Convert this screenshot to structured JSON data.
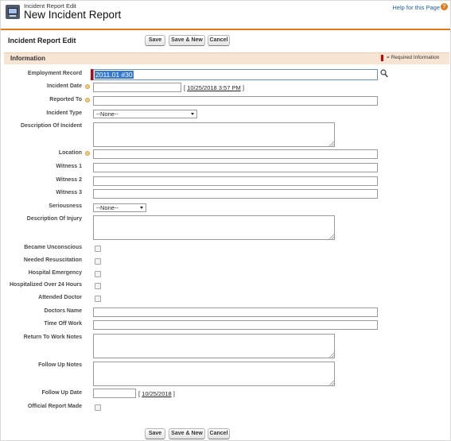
{
  "header": {
    "subtitle": "Incident Report Edit",
    "title": "New Incident Report",
    "help_link": "Help for this Page",
    "help_icon_glyph": "?"
  },
  "toolbar": {
    "section_title": "Incident Report Edit",
    "save_label": "Save",
    "save_new_label": "Save & New",
    "cancel_label": "Cancel"
  },
  "info": {
    "title": "Information",
    "required_legend": "= Required Information"
  },
  "fields": {
    "employment_record": {
      "label": "Employment Record",
      "value": "2011.01 #30",
      "required": true
    },
    "incident_date": {
      "label": "Incident Date",
      "value": "",
      "today_link": "10/25/2018 3:57 PM"
    },
    "reported_to": {
      "label": "Reported To",
      "value": ""
    },
    "incident_type": {
      "label": "Incident Type",
      "selected": "--None--"
    },
    "description_of_incident": {
      "label": "Description Of Incident",
      "value": ""
    },
    "location": {
      "label": "Location",
      "value": ""
    },
    "witness_1": {
      "label": "Witness 1",
      "value": ""
    },
    "witness_2": {
      "label": "Witness 2",
      "value": ""
    },
    "witness_3": {
      "label": "Witness 3",
      "value": ""
    },
    "seriousness": {
      "label": "Seriousness",
      "selected": "--None--"
    },
    "description_of_injury": {
      "label": "Description Of Injury",
      "value": ""
    },
    "became_unconscious": {
      "label": "Became Unconscious",
      "checked": false
    },
    "needed_resuscitation": {
      "label": "Needed Resuscitation",
      "checked": false
    },
    "hospital_emergency": {
      "label": "Hospital Emergency",
      "checked": false
    },
    "hospitalized_24h": {
      "label": "Hospitalized Over 24 Hours",
      "checked": false
    },
    "attended_doctor": {
      "label": "Attended Doctor",
      "checked": false
    },
    "doctors_name": {
      "label": "Doctors Name",
      "value": ""
    },
    "time_off_work": {
      "label": "Time Off Work",
      "value": ""
    },
    "return_to_work_notes": {
      "label": "Return To Work Notes",
      "value": ""
    },
    "follow_up_notes": {
      "label": "Follow Up Notes",
      "value": ""
    },
    "follow_up_date": {
      "label": "Follow Up Date",
      "value": "",
      "today_link": "10/25/2018"
    },
    "official_report_made": {
      "label": "Official Report Made",
      "checked": false
    }
  },
  "colors": {
    "accent": "#e07a19",
    "section_bg": "#f7e4d3",
    "required": "#cc0000",
    "selection": "#3478d4",
    "link": "#1f5fa8"
  },
  "icons": {
    "object": "computer-monitor-icon",
    "lookup": "magnifier-lookup-icon",
    "help": "help-question-icon",
    "field_help": "info-bubble-icon",
    "dropdown": "dropdown-arrow-icon",
    "resize": "resize-grip-icon"
  }
}
